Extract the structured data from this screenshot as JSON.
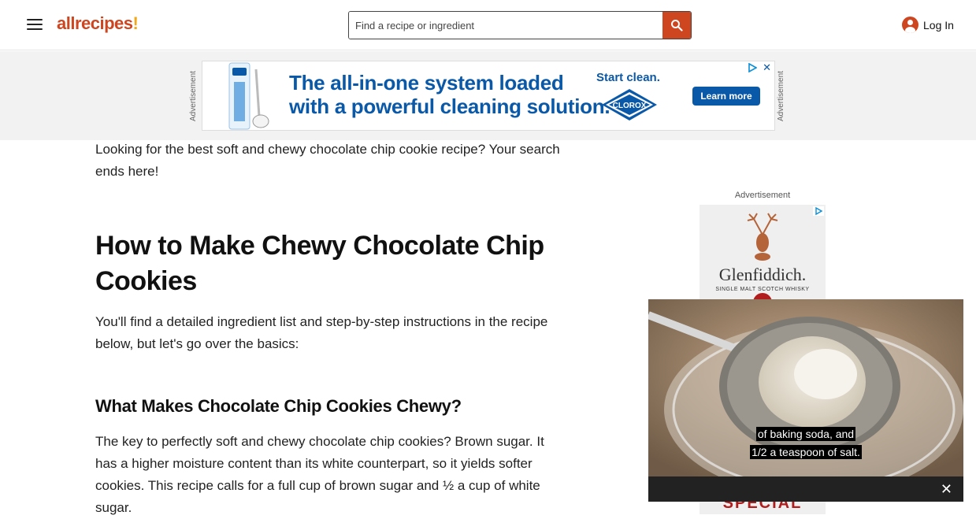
{
  "header": {
    "logo_text": "allrecipes",
    "logo_mark": "!",
    "search_placeholder": "Find a recipe or ingredient",
    "login_label": "Log In"
  },
  "top_ad": {
    "side_label_left": "Advertisement",
    "side_label_right": "Advertisement",
    "headline_line1": "The all-in-one system loaded",
    "headline_line2": "with a powerful cleaning solution.",
    "start_text": "Start clean.",
    "brand": "CLOROX",
    "cta": "Learn more",
    "close_symbol": "✕"
  },
  "article": {
    "intro": "Looking for the best soft and chewy chocolate chip cookie recipe? Your search ends here!",
    "heading": "How to Make Chewy Chocolate Chip Cookies",
    "para2": "You'll find a detailed ingredient list and step-by-step instructions in the recipe below, but let's go over the basics:",
    "subheading": "What Makes Chocolate Chip Cookies Chewy?",
    "para3": "The key to perfectly soft and chewy chocolate chip cookies? Brown sugar. It has a higher moisture content than its white counterpart, so it yields softer cookies. This recipe calls for a full cup of brown sugar and ½ a cup of white sugar."
  },
  "right_ad": {
    "label": "Advertisement",
    "brand": "Glenfiddich.",
    "tagline": "SINGLE MALT SCOTCH WHISKY",
    "bottom_text": "SPECIAL"
  },
  "video": {
    "caption_line1": "of baking soda, and",
    "caption_line2": "1/2 a teaspoon of salt.",
    "close_symbol": "✕"
  },
  "colors": {
    "brand": "#ce4620",
    "accent": "#f0a818",
    "ad_blue": "#0a58a8"
  }
}
